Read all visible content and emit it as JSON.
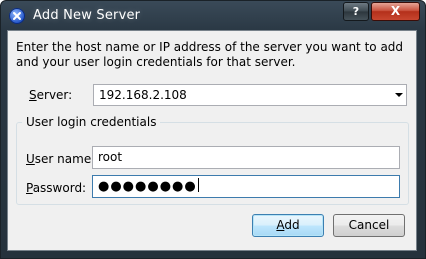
{
  "window": {
    "title": "Add New Server",
    "help_label": "?",
    "close_label": "X"
  },
  "intro": {
    "line1": "Enter the host name or IP address of the server you want to add",
    "line2": "and your user login credentials for that server."
  },
  "server": {
    "label_accel": "S",
    "label_rest": "erver:",
    "value": "192.168.2.108"
  },
  "credentials": {
    "group_title": "User login credentials",
    "username_accel": "U",
    "username_rest": "ser name:",
    "username_value": "root",
    "password_accel": "P",
    "password_rest": "assword:",
    "password_value": "●●●●●●●●"
  },
  "buttons": {
    "add_accel": "A",
    "add_rest": "dd",
    "cancel": "Cancel"
  }
}
